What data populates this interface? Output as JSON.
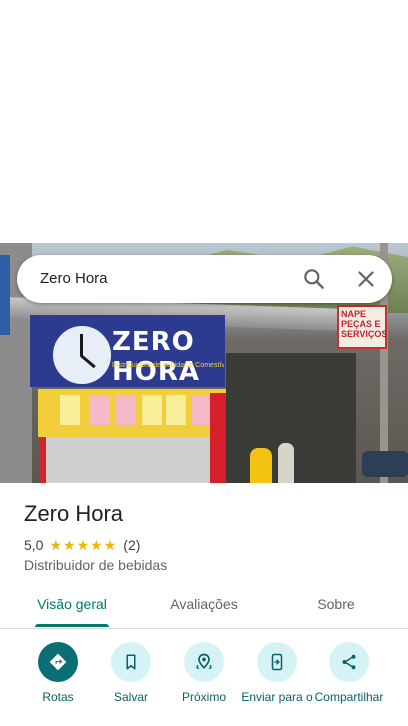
{
  "place": {
    "name": "Zero Hora",
    "rating": "5,0",
    "stars": [
      "★",
      "★",
      "★",
      "★",
      "★"
    ],
    "review_count": "(2)",
    "category": "Distribuidor de bebidas"
  },
  "search": {
    "query": "Zero Hora",
    "search_icon": "search-icon",
    "close_icon": "close-icon"
  },
  "photo": {
    "sign_main": "ZERO HORA",
    "sign_sub": "Distribuidora de bebidas e Comestíveis em geral",
    "sign_right": "NAPE PEÇAS E SERVIÇOS"
  },
  "tabs": [
    {
      "label": "Visão geral",
      "active": true
    },
    {
      "label": "Avaliações",
      "active": false
    },
    {
      "label": "Sobre",
      "active": false
    }
  ],
  "actions": [
    {
      "label": "Rotas",
      "icon": "directions-icon"
    },
    {
      "label": "Salvar",
      "icon": "bookmark-icon"
    },
    {
      "label": "Próximo",
      "icon": "nearby-icon"
    },
    {
      "label": "Enviar para o",
      "icon": "send-to-phone-icon"
    },
    {
      "label": "Compartilhar",
      "icon": "share-icon"
    }
  ],
  "colors": {
    "accent": "#00796b",
    "primary_button": "#0a6e74",
    "button_bg": "#d5f3f6",
    "star": "#f4b400"
  }
}
